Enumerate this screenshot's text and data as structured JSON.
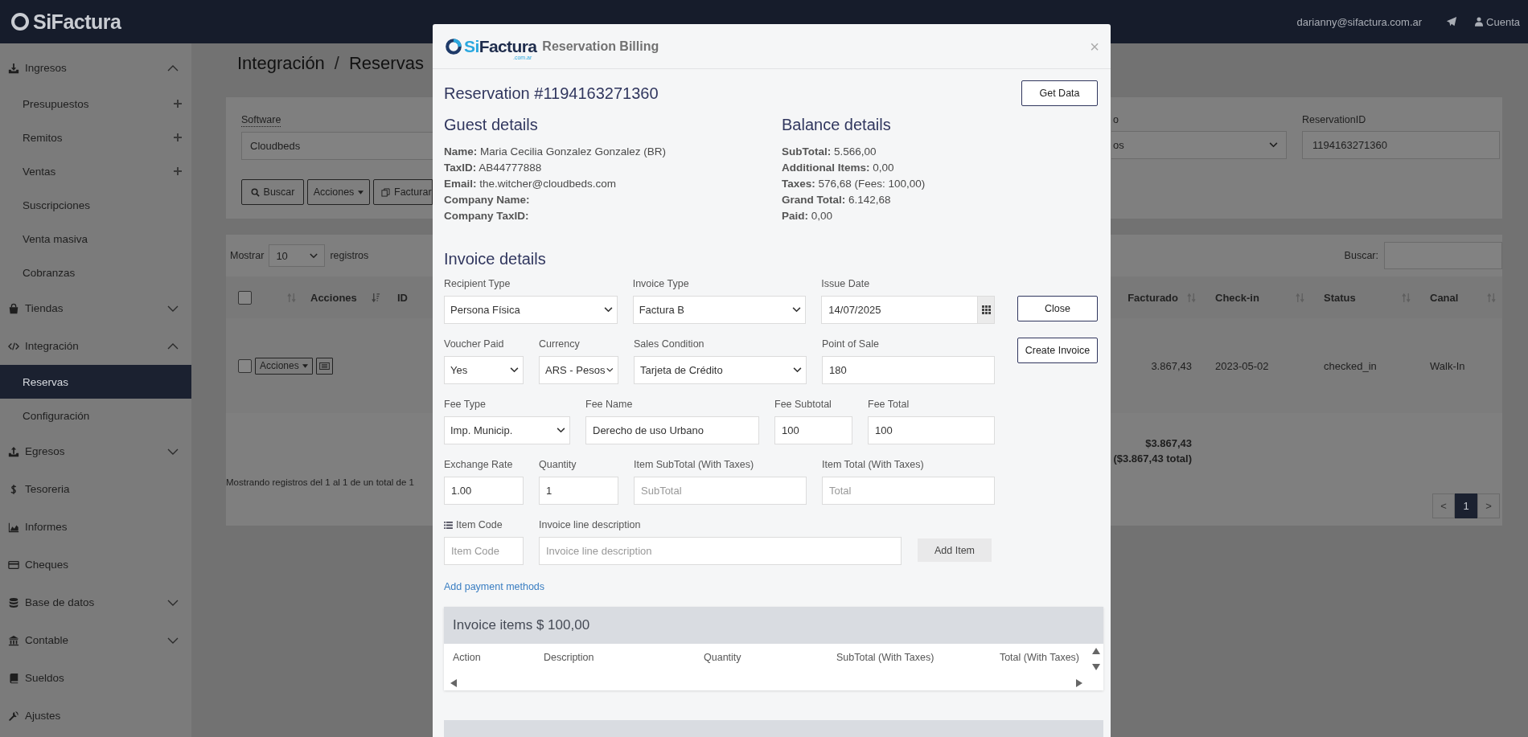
{
  "topbar": {
    "brand": "SiFactura",
    "user_email": "darianny@sifactura.com.ar",
    "account_label": "Cuenta"
  },
  "sidebar": {
    "items": [
      {
        "label": "Ingresos",
        "kind": "group",
        "expanded": true,
        "selected": false,
        "children": [
          {
            "label": "Presupuestos",
            "selected": false,
            "addable": true
          },
          {
            "label": "Remitos",
            "selected": false,
            "addable": true
          },
          {
            "label": "Ventas",
            "selected": false,
            "addable": true
          },
          {
            "label": "Suscripciones",
            "selected": false,
            "addable": false
          },
          {
            "label": "Venta masiva",
            "selected": false,
            "addable": false
          },
          {
            "label": "Cobranzas",
            "selected": false,
            "addable": false
          }
        ]
      },
      {
        "label": "Tiendas",
        "kind": "group",
        "expanded": false,
        "selected": false
      },
      {
        "label": "Integración",
        "kind": "group",
        "expanded": true,
        "selected": false,
        "children": [
          {
            "label": "Reservas",
            "selected": true,
            "addable": false
          },
          {
            "label": "Configuración",
            "selected": false,
            "addable": false
          }
        ]
      },
      {
        "label": "Egresos",
        "kind": "group",
        "expanded": false,
        "selected": false
      },
      {
        "label": "Tesoreria",
        "kind": "link",
        "selected": false
      },
      {
        "label": "Informes",
        "kind": "link",
        "selected": false
      },
      {
        "label": "Cheques",
        "kind": "link",
        "selected": false
      },
      {
        "label": "Base de datos",
        "kind": "group",
        "expanded": false,
        "selected": false
      },
      {
        "label": "Contable",
        "kind": "group",
        "expanded": false,
        "selected": false
      },
      {
        "label": "Sueldos",
        "kind": "link",
        "selected": false
      },
      {
        "label": "Ajustes",
        "kind": "link",
        "selected": false
      }
    ]
  },
  "page": {
    "breadcrumb": [
      "Integración",
      "Reservas"
    ],
    "separator": "/",
    "filters": {
      "software_label": "Software",
      "software_value": "Cloudbeds",
      "buttons": [
        {
          "label": "Buscar",
          "kind": "search"
        },
        {
          "label": "Acciones",
          "kind": "dropdown"
        },
        {
          "label": "Facturar",
          "kind": "invoice"
        }
      ],
      "status_label": "o",
      "status_value": "os",
      "reservation_label": "ReservationID",
      "reservation_value": "1194163271360"
    },
    "table": {
      "length_prefix": "Mostrar",
      "length_value": "10",
      "length_suffix": "registros",
      "search_label": "Buscar:",
      "select_all_checked": false,
      "left_columns": [
        "Acciones",
        "ID"
      ],
      "right_columns": [
        "Facturado",
        "Check-in",
        "Status",
        "Canal"
      ],
      "row": {
        "checked": false,
        "action_label": "Acciones",
        "facturado": "3.867,43",
        "check_in": "2023-05-02",
        "status": "checked_in",
        "canal": "Walk-In"
      },
      "total": "$3.867,43",
      "grand_total": "($3.867,43 total)",
      "info": "Mostrando registros del 1 al 1 de un total de 1",
      "pages": [
        {
          "label": "<",
          "selected": false
        },
        {
          "label": "1",
          "selected": true
        },
        {
          "label": ">",
          "selected": false
        }
      ]
    }
  },
  "modal": {
    "brand_prefix": "Si",
    "brand_name": "Factura",
    "brand_suffix": ".com.ar",
    "title": "Reservation Billing",
    "close_symbol": "×",
    "reservation": "Reservation #1194163271360",
    "get_data": "Get Data",
    "guest": {
      "title": "Guest details",
      "fields": [
        {
          "label": "Name:",
          "value": "Maria Cecilia Gonzalez Gonzalez (BR)"
        },
        {
          "label": "TaxID:",
          "value": "AB44777888"
        },
        {
          "label": "Email:",
          "value": "the.witcher@cloudbeds.com"
        },
        {
          "label": "Company Name:"
        },
        {
          "label": "Company TaxID:"
        }
      ]
    },
    "balance": {
      "title": "Balance details",
      "fields": [
        {
          "label": "SubTotal:",
          "value": "5.566,00"
        },
        {
          "label": "Additional Items:",
          "value": "0,00"
        },
        {
          "label": "Taxes:",
          "value": "576,68 (Fees: 100,00)"
        },
        {
          "label": "Grand Total:",
          "value": "6.142,68"
        },
        {
          "label": "Paid:",
          "value": "0,00"
        }
      ]
    },
    "invoice": {
      "title": "Invoice details",
      "rows": [
        [
          {
            "label": "Recipient Type",
            "kind": "select",
            "value": "Persona Física"
          },
          {
            "label": "Invoice Type",
            "kind": "select",
            "value": "Factura B"
          },
          {
            "label": "Issue Date",
            "kind": "date",
            "value": "14/07/2025"
          }
        ],
        [
          {
            "label": "Voucher Paid",
            "kind": "select",
            "value": "Yes"
          },
          {
            "label": "Currency",
            "kind": "select",
            "value": "ARS - Pesos"
          },
          {
            "label": "Sales Condition",
            "kind": "select",
            "value": "Tarjeta de Crédito"
          },
          {
            "label": "Point of Sale",
            "kind": "text",
            "value": "180"
          }
        ],
        [
          {
            "label": "Fee Type",
            "kind": "select",
            "value": "Imp. Municip."
          },
          {
            "label": "Fee Name",
            "kind": "text",
            "value": "Derecho de uso Urbano"
          },
          {
            "label": "Fee Subtotal",
            "kind": "text",
            "value": "100"
          },
          {
            "label": "Fee Total",
            "kind": "text",
            "value": "100"
          }
        ],
        [
          {
            "label": "Exchange Rate",
            "kind": "text",
            "value": "1.00"
          },
          {
            "label": "Quantity",
            "kind": "text",
            "value": "1"
          },
          {
            "label": "Item SubTotal (With Taxes)",
            "kind": "text",
            "placeholder": "SubTotal"
          },
          {
            "label": "Item Total (With Taxes)",
            "kind": "text",
            "placeholder": "Total"
          }
        ],
        [
          {
            "label": "Item Code",
            "kind": "text",
            "placeholder": "Item Code"
          },
          {
            "label": "Invoice line description",
            "kind": "text",
            "placeholder": "Invoice line description"
          },
          {
            "label": "Add Item",
            "kind": "button"
          }
        ]
      ],
      "actions": [
        "Close",
        "Create Invoice"
      ],
      "payment_link": "Add payment methods"
    },
    "items_panel": {
      "title": "Invoice items $ 100,00",
      "columns": [
        "Action",
        "Description",
        "Quantity",
        "SubTotal (With Taxes)",
        "Total (With Taxes)"
      ]
    }
  }
}
